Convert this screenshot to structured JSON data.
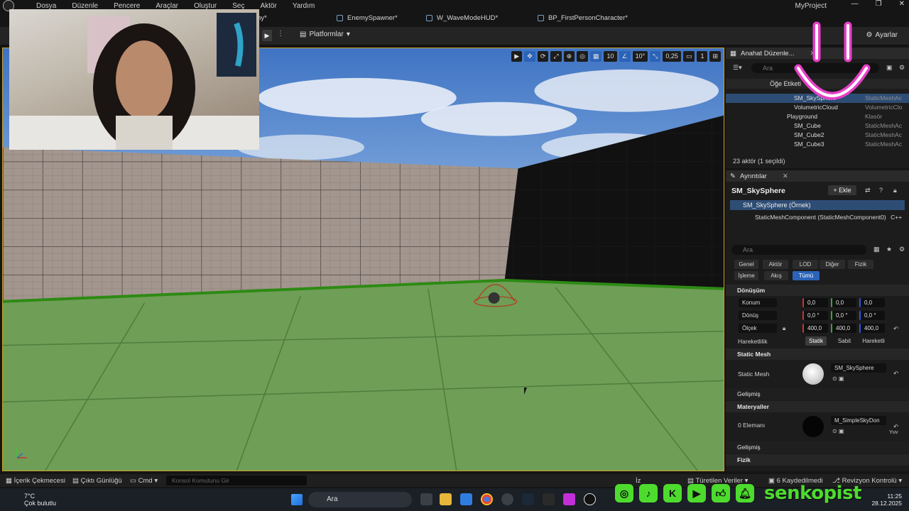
{
  "menu": [
    "Dosya",
    "Düzenle",
    "Pencere",
    "Araçlar",
    "Oluştur",
    "Seç",
    "Aktör",
    "Yardım"
  ],
  "project_name": "MyProject",
  "window_controls": [
    "—",
    "❐",
    "✕"
  ],
  "tabs": [
    "ny*",
    "EnemySpawner*",
    "W_WaveModeHUD*",
    "BP_FirstPersonCharacter*"
  ],
  "toolbar": {
    "platforms": "Platformlar",
    "settings": "Ayarlar",
    "play_more": "⋮"
  },
  "viewport": {
    "tools": [
      "▶",
      "✥",
      "⟳",
      "⤢",
      "⊕",
      "◎",
      "▦",
      "10",
      "∠",
      "10°",
      "⤡",
      "0,25",
      "▭",
      "1",
      "⊞"
    ]
  },
  "outliner": {
    "tab_label": "Anahat Düzenle...",
    "search_placeholder": "Ara",
    "header_label": "Öğe Etiketi",
    "rows": [
      {
        "name": "SM_SkySphere",
        "type": "StaticMeshAc",
        "selected": true
      },
      {
        "name": "VolumetricCloud",
        "type": "VolumetricClo",
        "selected": false
      },
      {
        "name": "Playground",
        "type": "Klasör",
        "selected": false
      },
      {
        "name": "SM_Cube",
        "type": "StaticMeshAc",
        "selected": false
      },
      {
        "name": "SM_Cube2",
        "type": "StaticMeshAc",
        "selected": false
      },
      {
        "name": "SM_Cube3",
        "type": "StaticMeshAc",
        "selected": false
      }
    ],
    "count": "23 aktör (1 seçildi)"
  },
  "details": {
    "tab_label": "Ayrıntılar",
    "title": "SM_SkySphere",
    "add_label": "Ekle",
    "component_selected": "SM_SkySphere (Örnek)",
    "component": "StaticMeshComponent (StaticMeshComponent0)",
    "component_suffix": "C++",
    "search_placeholder": "Ara",
    "filters_row1": [
      "Genel",
      "Aktör",
      "LOD",
      "Diğer",
      "Fizik"
    ],
    "filters_row2": [
      "İşleme",
      "Akış",
      "Tümü"
    ],
    "transform": {
      "header": "Dönüşüm",
      "location_label": "Konum",
      "location": [
        "0,0",
        "0,0",
        "0,0"
      ],
      "rotation_label": "Dönüş",
      "rotation": [
        "0,0 °",
        "0,0 °",
        "0,0 °"
      ],
      "scale_label": "Ölçek",
      "scale": [
        "400,0",
        "400,0",
        "400,0"
      ],
      "mobility_label": "Hareketlilik",
      "mobility": [
        "Statik",
        "Sabit",
        "Hareketli"
      ]
    },
    "static_mesh": {
      "header": "Static Mesh",
      "label": "Static Mesh",
      "value": "SM_SkySphere",
      "advanced": "Gelişmiş"
    },
    "materials": {
      "header": "Materyaller",
      "label": "0 Elemanı",
      "value": "M_SimpleSkyDon",
      "suffix": "Yuv",
      "advanced": "Gelişmiş"
    },
    "physics": {
      "header": "Fizik"
    }
  },
  "statusbar": {
    "content_drawer": "İçerik Çekmecesi",
    "output_log": "Çıktı Günlüğü",
    "cmd": "Cmd",
    "console_placeholder": "Konsol Komutunu Gir",
    "derived": "Türetilen Veriler",
    "saved": "6 Kaydedilmedi",
    "revision": "Revizyon Kontrolü",
    "iz": "İz"
  },
  "taskbar": {
    "temp": "7°C",
    "weather": "Çok bulutlu",
    "search": "Ara",
    "time": "11:25",
    "date": "28.12.2025"
  },
  "overlay": {
    "brand": "senkopist",
    "social_icons": [
      "instagram-icon",
      "tiktok-icon",
      "kick-icon",
      "youtube-icon",
      "thumbs-up-icon",
      "bell-icon"
    ]
  },
  "colors": {
    "accent": "#2b63b8",
    "brand_green": "#4ddc2e",
    "smiley_pink": "#e83fc8",
    "viewport_border": "#c9a227"
  }
}
